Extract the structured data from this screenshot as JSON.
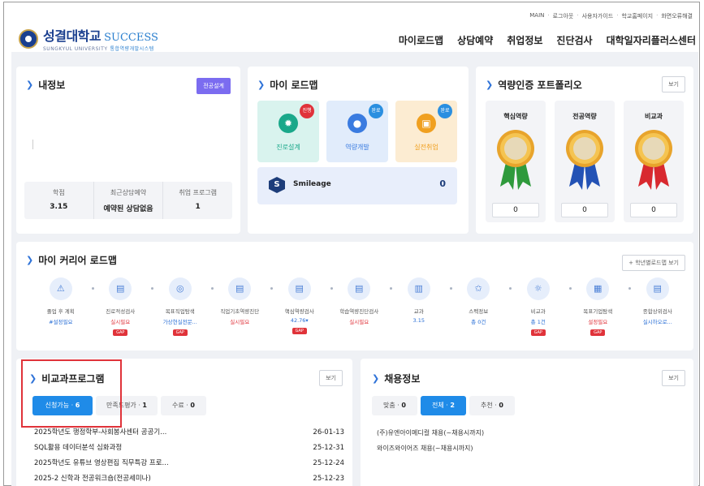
{
  "header": {
    "top_links": [
      "MAIN",
      "로그아웃",
      "사용자가이드",
      "학교홈페이지",
      "화면오류해결"
    ],
    "logo_ko": "성결대학교",
    "logo_en": "SUCCESS",
    "logo_sub_en": "SUNGKYUL UNIVERSITY",
    "logo_sub_ko": "통합역량개발시스템",
    "main_nav": [
      "마이로드맵",
      "상담예약",
      "취업정보",
      "진단검사",
      "대학일자리플러스센터"
    ]
  },
  "info_card": {
    "title": "내정보",
    "button": "전공설계",
    "stats": [
      {
        "label": "학점",
        "value": "3.15"
      },
      {
        "label": "최근상담예약",
        "value": "예약된 상담없음"
      },
      {
        "label": "취업 프로그램",
        "value": "1"
      }
    ]
  },
  "my_roadmap": {
    "title": "마이 로드맵",
    "tiles": [
      {
        "label": "진로설계",
        "badge": "진행",
        "bg": "#d9f3ee",
        "icon_bg": "#1aa88a",
        "badge_bg": "#e0333a",
        "icon": "gear-icon"
      },
      {
        "label": "역량개발",
        "badge": "완료",
        "bg": "#e1ecfb",
        "icon_bg": "#3a7be0",
        "badge_bg": "#2a8fe0",
        "icon": "person-icon"
      },
      {
        "label": "실전취업",
        "badge": "완료",
        "bg": "#fcecd2",
        "icon_bg": "#f0a020",
        "badge_bg": "#2a8fe0",
        "icon": "briefcase-icon"
      }
    ],
    "smileage": {
      "label": "Smileage",
      "value": "0",
      "icon": "S"
    }
  },
  "portfolio": {
    "title": "역량인증 포트폴리오",
    "view": "보기",
    "items": [
      {
        "label": "핵심역량",
        "value": "0",
        "ribbon": "#2f9a3c"
      },
      {
        "label": "전공역량",
        "value": "0",
        "ribbon": "#2352b5"
      },
      {
        "label": "비교과",
        "value": "0",
        "ribbon": "#d8292f"
      }
    ]
  },
  "career_roadmap": {
    "title": "마이 커리어 로드맵",
    "button": "+ 학년별로드맵 보기",
    "steps": [
      {
        "label": "졸업 후 계획",
        "value": "#설정필요",
        "value_color": "#2a6fd6",
        "gap": false,
        "icon": "warning-icon"
      },
      {
        "label": "진로적성검사",
        "value": "실시필요",
        "value_color": "#e0333a",
        "gap": true,
        "icon": "clipboard-icon"
      },
      {
        "label": "목표직업탐색",
        "value": "가상현실전문...",
        "value_color": "#2a6fd6",
        "gap": true,
        "icon": "target-icon"
      },
      {
        "label": "직업기초역량진단",
        "value": "실시필요",
        "value_color": "#e0333a",
        "gap": false,
        "icon": "clipboard-icon"
      },
      {
        "label": "핵심역량검사",
        "value": "42.76▾",
        "value_color": "#2a6fd6",
        "gap": true,
        "icon": "clipboard-icon"
      },
      {
        "label": "학습역량진단검사",
        "value": "실시필요",
        "value_color": "#e0333a",
        "gap": false,
        "icon": "clipboard-icon"
      },
      {
        "label": "교과",
        "value": "3.15",
        "value_color": "#2a6fd6",
        "gap": false,
        "icon": "book-icon"
      },
      {
        "label": "스펙정보",
        "value": "총 0건",
        "value_color": "#2a6fd6",
        "gap": false,
        "icon": "star-icon"
      },
      {
        "label": "비교과",
        "value": "총 1건",
        "value_color": "#2a6fd6",
        "gap": true,
        "icon": "bulb-icon"
      },
      {
        "label": "목표기업탐색",
        "value": "설정필요",
        "value_color": "#e0333a",
        "gap": true,
        "icon": "building-icon"
      },
      {
        "label": "종합상위검사",
        "value": "실시하오로...",
        "value_color": "#2a6fd6",
        "gap": false,
        "icon": "clipboard-icon"
      }
    ],
    "gap_label": "GAP"
  },
  "extracurricular": {
    "title": "비교과프로그램",
    "view": "보기",
    "tabs": [
      {
        "label": "신청가능",
        "count": "6",
        "active": true
      },
      {
        "label": "만족도평가",
        "count": "1",
        "active": false
      },
      {
        "label": "수료",
        "count": "0",
        "active": false
      }
    ],
    "rows": [
      {
        "title": "2025학년도 행정학부-사회봉사센터 공공기...",
        "date": "26-01-13"
      },
      {
        "title": "SQL활용 데이터분석 심화과정",
        "date": "25-12-31"
      },
      {
        "title": "2025학년도 유튜브 영상편집 직무특강 프로...",
        "date": "25-12-24"
      },
      {
        "title": "2025-2 신학과 전공워크숍(전공세미나)",
        "date": "25-12-23"
      }
    ]
  },
  "jobs": {
    "title": "채용정보",
    "view": "보기",
    "tabs": [
      {
        "label": "맞춤",
        "count": "0",
        "active": false
      },
      {
        "label": "전체",
        "count": "2",
        "active": true
      },
      {
        "label": "추천",
        "count": "0",
        "active": false
      }
    ],
    "rows": [
      "(주)유엔아이메디컬 채용(~채용시까지)",
      "와이즈와이어즈 채용(~채용시까지)"
    ]
  }
}
